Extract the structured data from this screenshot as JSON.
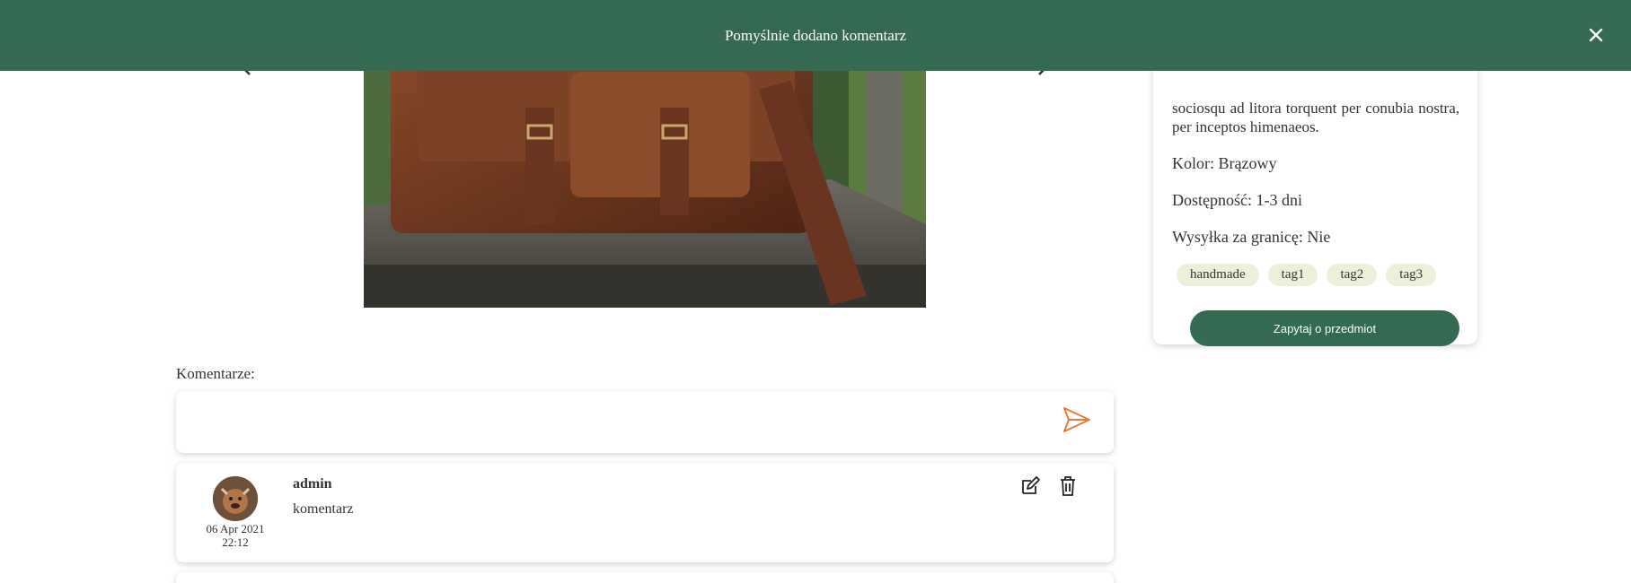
{
  "toast": {
    "message": "Pomyślnie dodano komentarz",
    "close_icon": "close-icon",
    "background": "#346a52"
  },
  "gallery": {
    "image_alt": "brown leather messenger bag",
    "prev_icon": "chevron-left-icon",
    "next_icon": "chevron-right-icon"
  },
  "product": {
    "description_tail": "sociosqu ad litora torquent per conubia nostra, per inceptos himenaeos.",
    "color": "Kolor: Brązowy",
    "availability": "Dostępność: 1-3 dni",
    "shipping_abroad": "Wysyłka za granicę: Nie",
    "tags": [
      "handmade",
      "tag1",
      "tag2",
      "tag3"
    ],
    "ask_button": "Zapytaj o przedmiot"
  },
  "comments": {
    "label": "Komentarze:",
    "input_value": "",
    "send_icon": "send-icon",
    "items": [
      {
        "author": "admin",
        "text": "komentarz",
        "date": "06 Apr 2021",
        "time": "22:12",
        "edit_icon": "edit-icon",
        "delete_icon": "trash-icon"
      }
    ]
  },
  "colors": {
    "primary": "#346a52",
    "send_accent": "#e87a3a",
    "tag_bg": "#edf0d9"
  }
}
